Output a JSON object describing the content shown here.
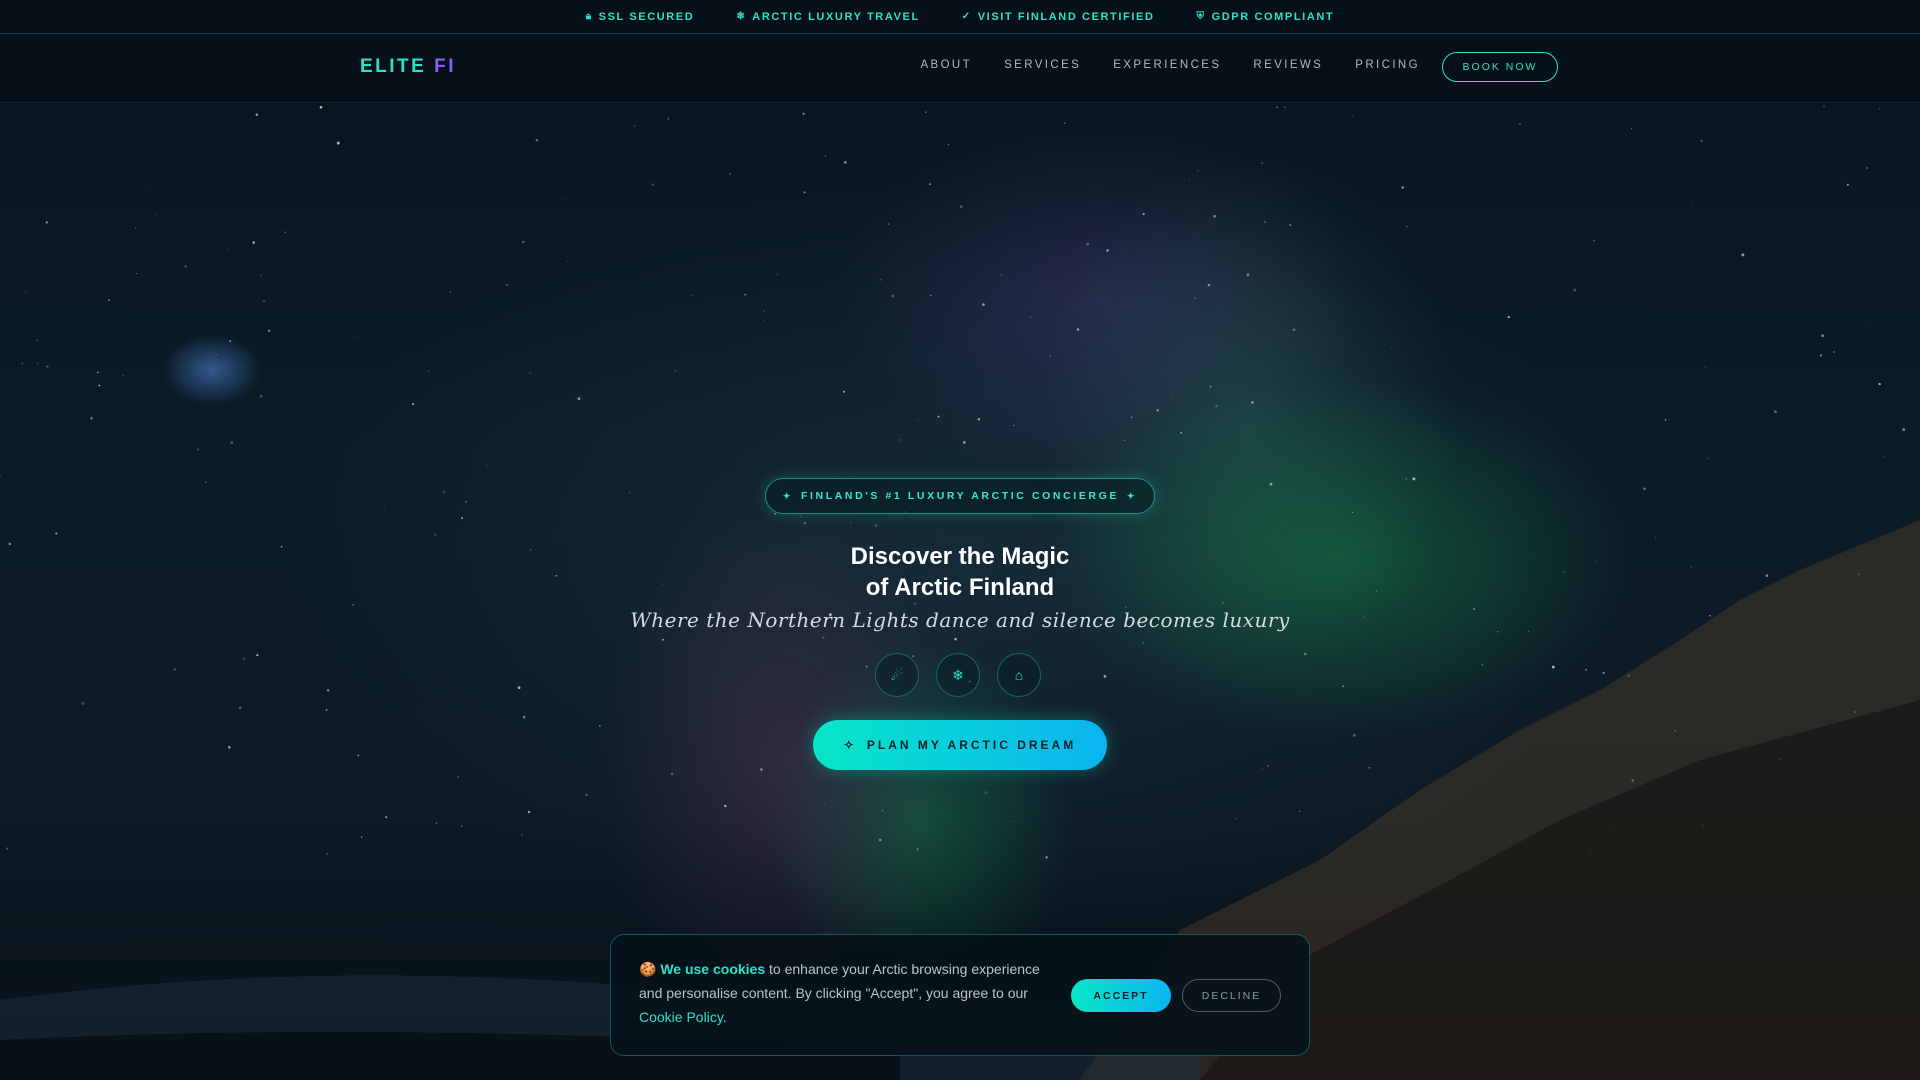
{
  "topbar": {
    "items": [
      {
        "icon": "lock-icon",
        "label": "SSL SECURED"
      },
      {
        "icon": "snowflake-icon",
        "label": "ARCTIC LUXURY TRAVEL"
      },
      {
        "icon": "certificate-icon",
        "label": "VISIT FINLAND CERTIFIED"
      },
      {
        "icon": "shield-icon",
        "label": "GDPR COMPLIANT"
      }
    ]
  },
  "nav": {
    "logo_main": "ELITE ",
    "logo_accent": "FI",
    "links": [
      "ABOUT",
      "SERVICES",
      "EXPERIENCES",
      "REVIEWS",
      "PRICING"
    ],
    "book_label": "BOOK NOW"
  },
  "hero": {
    "badge": "FINLAND'S #1 LUXURY ARCTIC CONCIERGE",
    "title_line1": "Discover the Magic",
    "title_line2": "of Arctic Finland",
    "subtitle": "Where the Northern Lights dance and silence becomes luxury",
    "icons": [
      "aurora-icon",
      "sleigh-icon",
      "cabin-icon"
    ],
    "cta_label": "PLAN MY ARCTIC DREAM"
  },
  "cookie": {
    "emoji": "🍪",
    "strong": "We use cookies",
    "text": " to enhance your Arctic browsing experience and personalise content. By clicking \"Accept\", you agree to our ",
    "link": "Cookie Policy",
    "end": ".",
    "accept": "ACCEPT",
    "decline": "DECLINE"
  },
  "colors": {
    "accent": "#2fe0c8",
    "accent_purple": "#8b5cf6",
    "background": "#061019",
    "cta_gradient_start": "#08e6c7",
    "cta_gradient_end": "#0ab4f0"
  }
}
